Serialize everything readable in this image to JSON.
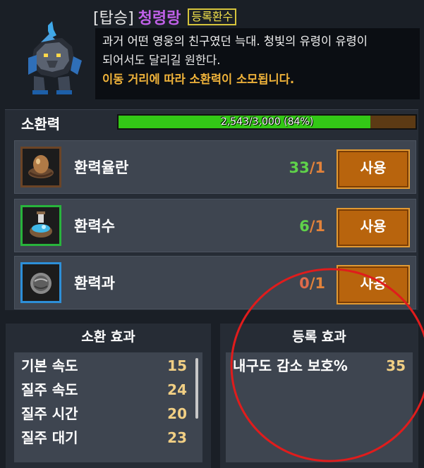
{
  "header": {
    "prefix": "[탑승]",
    "name": "청령랑",
    "badge": "등록환수",
    "description_line1": "과거 어떤 영웅의 친구였던 늑대. 청빛의 유령이 유령이",
    "description_line1b": "되어서도 달리길 원한다.",
    "description_line2": "이동 거리에 따라 소환력이 소모됩니다."
  },
  "summon_power": {
    "label": "소환력",
    "gauge_text": "2,543/3,000 (84%)",
    "fraction": 0.848
  },
  "items": [
    {
      "name": "환력율란",
      "owned": "33",
      "slash": "/1",
      "owned_color": "#5fd24a",
      "use_label": "사용",
      "icon": "egg-nest-icon",
      "frame_color": "#5b3a22"
    },
    {
      "name": "환력수",
      "owned": "6",
      "slash": "/1",
      "owned_color": "#5fd24a",
      "use_label": "사용",
      "icon": "potion-bowl-icon",
      "frame_color": "#28b43c"
    },
    {
      "name": "환력과",
      "owned": "0",
      "slash": "/1",
      "owned_color": "#e06a4a",
      "use_label": "사용",
      "icon": "stone-orb-icon",
      "frame_color": "#2d8fd8"
    }
  ],
  "summon_effects": {
    "title": "소환 효과",
    "stats": [
      {
        "label": "기본 속도",
        "value": "15"
      },
      {
        "label": "질주 속도",
        "value": "24"
      },
      {
        "label": "질주 시간",
        "value": "20"
      },
      {
        "label": "질주 대기",
        "value": "23"
      }
    ]
  },
  "register_effects": {
    "title": "등록 효과",
    "stats": [
      {
        "label": "내구도 감소 보호%",
        "value": "35"
      }
    ]
  },
  "annotation_color": "#e01c1c"
}
